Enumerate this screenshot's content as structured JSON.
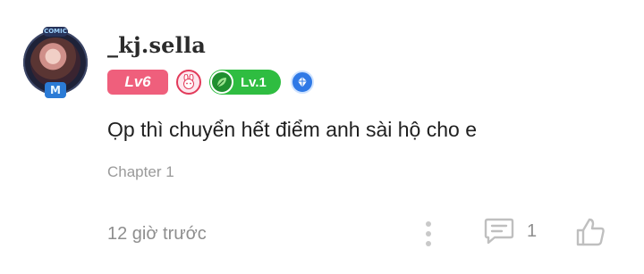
{
  "comment": {
    "user": {
      "username": "_kj.sella",
      "avatar_frame": {
        "tag": "COMIC",
        "emblem": "M"
      },
      "badges": [
        {
          "type": "level",
          "label": "Lv6",
          "color": "#ef5f7c"
        },
        {
          "type": "icon",
          "icon": "rabbit-icon",
          "color": "#e23a5a"
        },
        {
          "type": "level",
          "label": "Lv.1",
          "color": "#2fbd41",
          "icon": "leaf-icon"
        },
        {
          "type": "icon",
          "icon": "crystal-icon",
          "color": "#2f79e6"
        }
      ]
    },
    "text": "Ọp thì chuyển hết điểm anh sài hộ cho e",
    "chapter": "Chapter 1",
    "time": "12 giờ trước",
    "actions": {
      "more": "more-dots-icon",
      "reply_icon": "reply-icon",
      "reply_count": "1",
      "like_icon": "thumbs-up-icon"
    }
  }
}
